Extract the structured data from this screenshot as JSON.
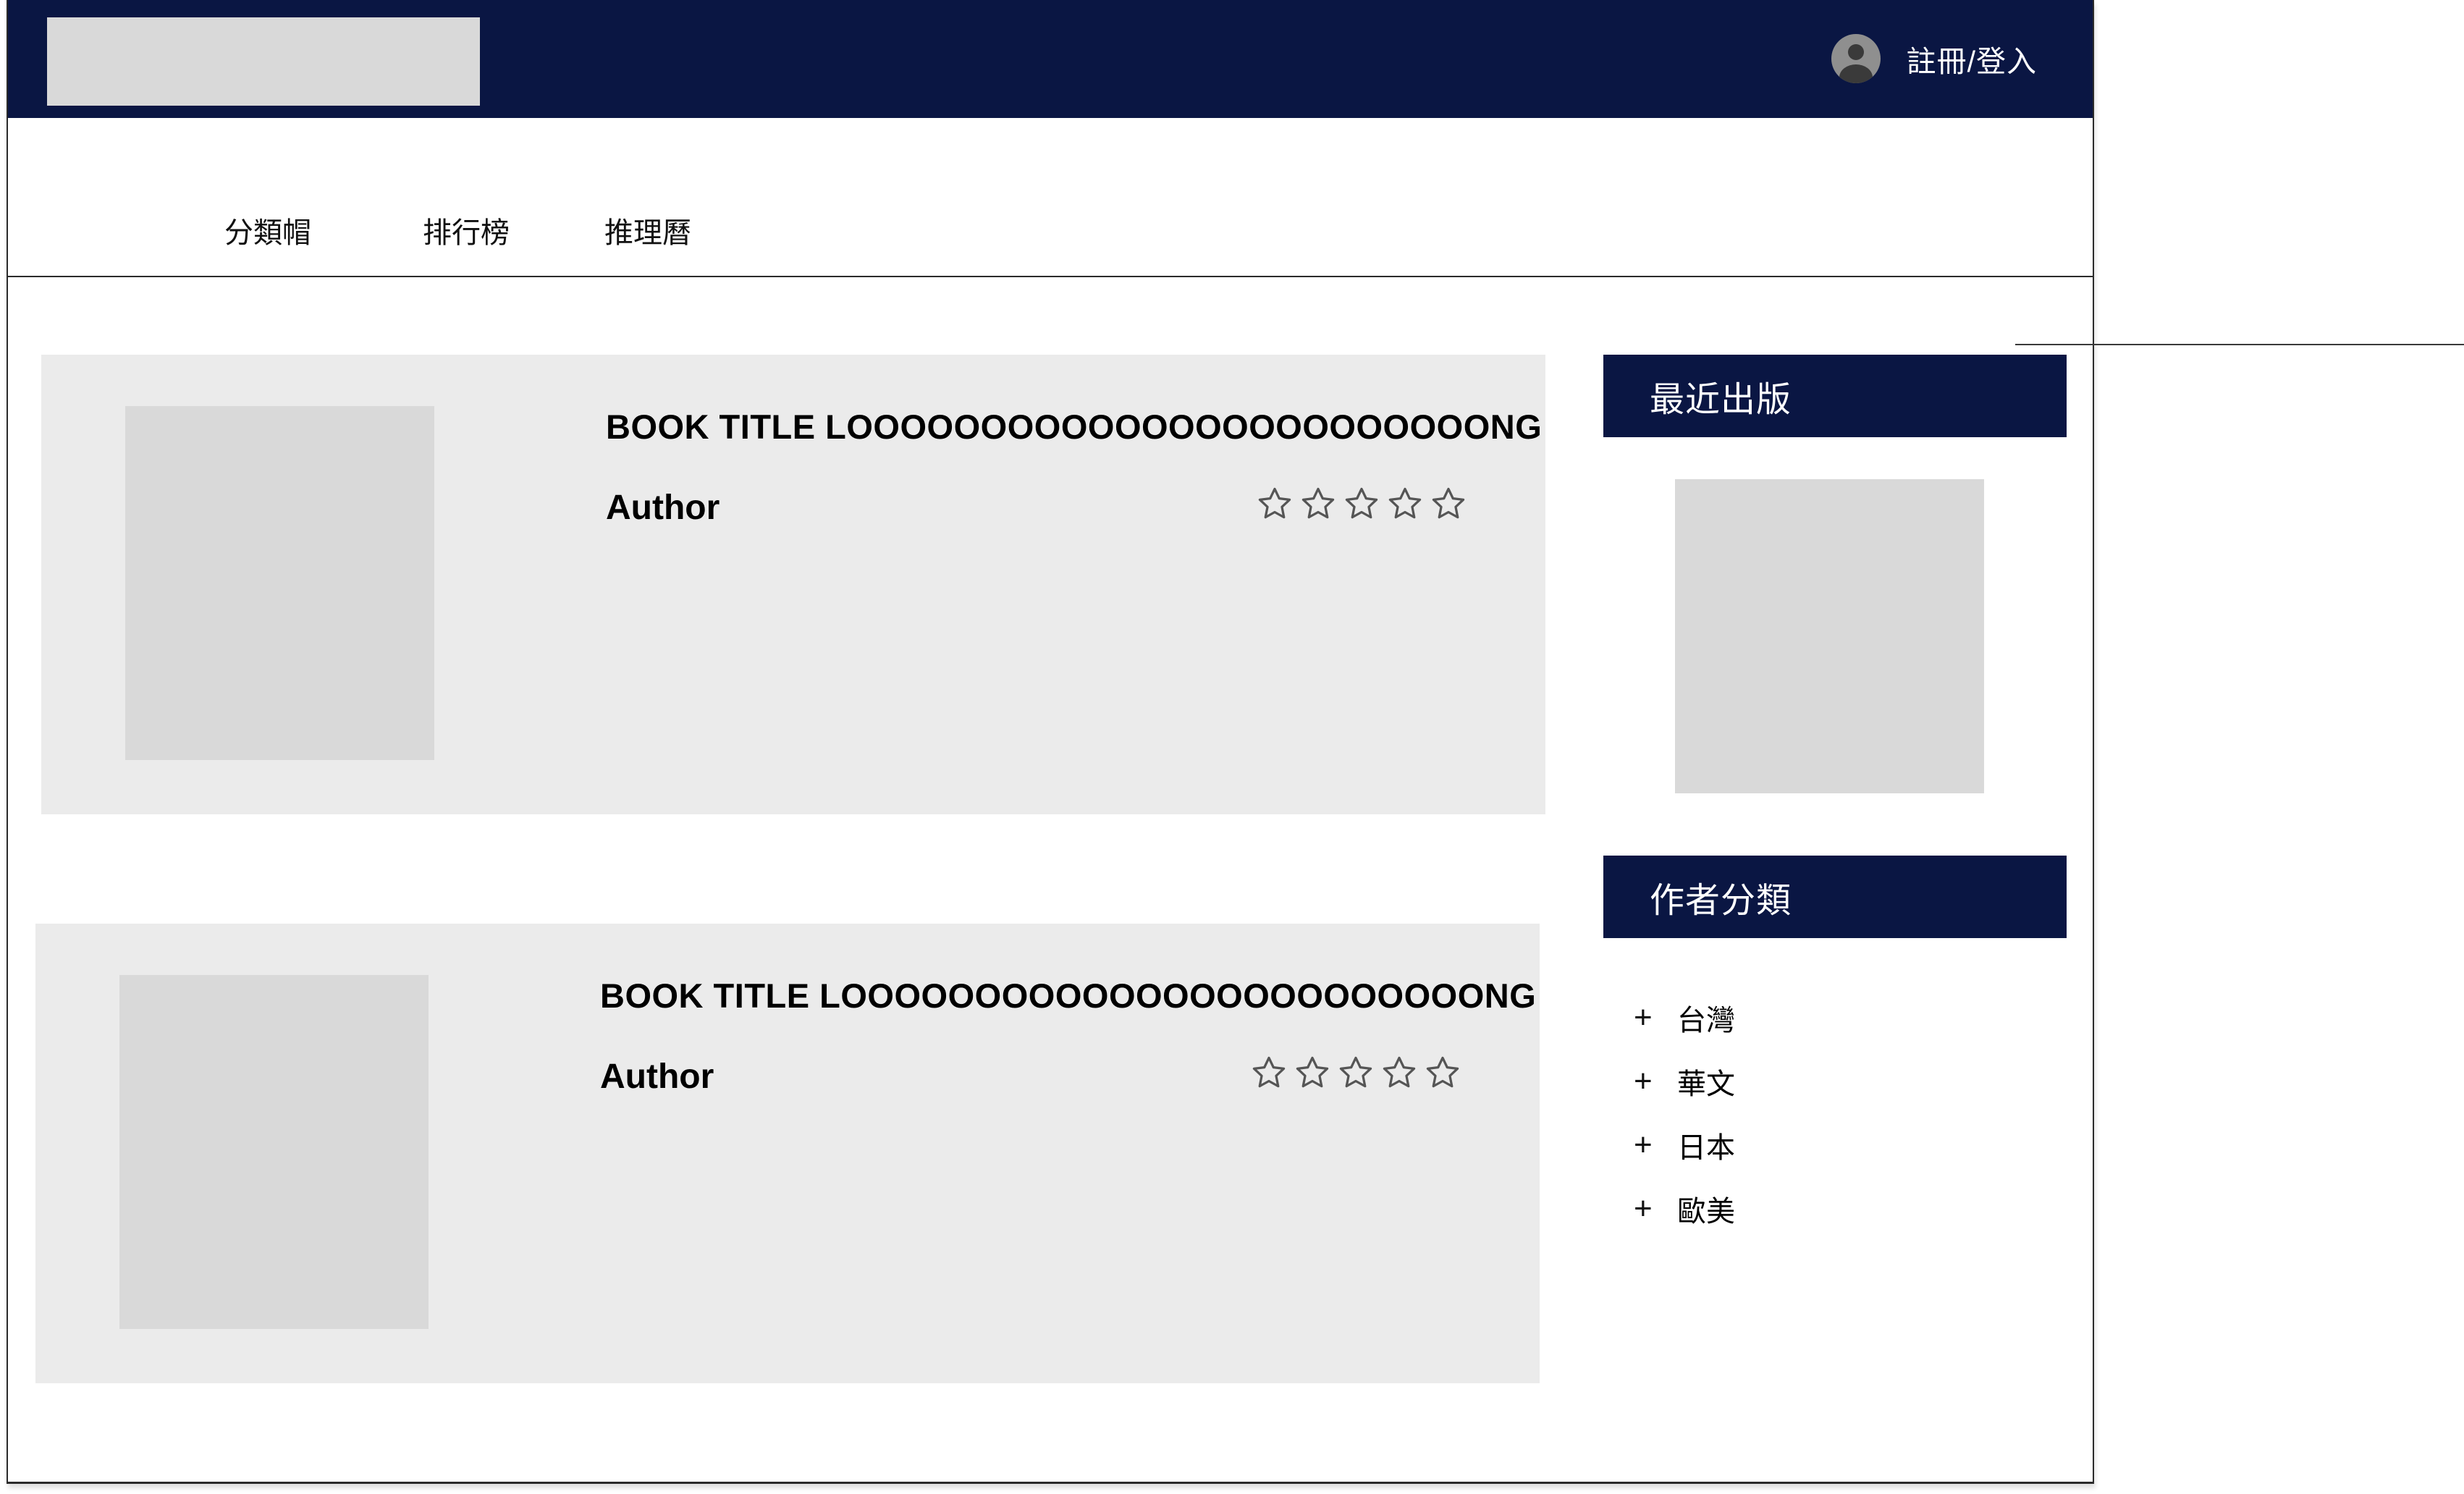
{
  "header": {
    "account_label": "註冊/登入"
  },
  "nav": {
    "items": [
      {
        "label": "分類帽"
      },
      {
        "label": "排行榜"
      },
      {
        "label": "推理曆"
      }
    ]
  },
  "books": [
    {
      "title": "BOOK TITLE LOOOOOOOOOOOOOOOOOOOOOOOONG",
      "author": "Author",
      "rating": 0,
      "rating_max": 5
    },
    {
      "title": "BOOK TITLE LOOOOOOOOOOOOOOOOOOOOOOOONG",
      "author": "Author",
      "rating": 0,
      "rating_max": 5
    }
  ],
  "sidebar": {
    "recent_title": "最近出版",
    "category_title": "作者分類",
    "categories": [
      {
        "label": "台灣",
        "icon": "plus-icon"
      },
      {
        "label": "華文",
        "icon": "plus-icon"
      },
      {
        "label": "日本",
        "icon": "plus-icon"
      },
      {
        "label": "歐美",
        "icon": "plus-icon"
      }
    ]
  },
  "colors": {
    "navy": "#0a1643",
    "card_bg": "#ebebeb",
    "placeholder": "#d9d9d9"
  }
}
